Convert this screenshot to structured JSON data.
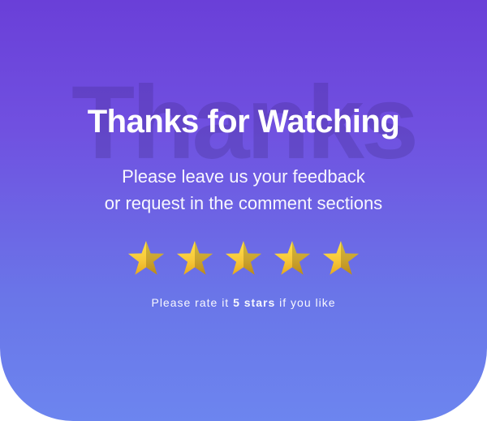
{
  "bg_word": "Thanks",
  "title": "Thanks for Watching",
  "subtitle_line1": "Please leave us your feedback",
  "subtitle_line2": "or request in the comment sections",
  "rate_prefix": "Please rate it ",
  "rate_bold": "5 stars",
  "rate_suffix": " if you like",
  "star_count": 5
}
